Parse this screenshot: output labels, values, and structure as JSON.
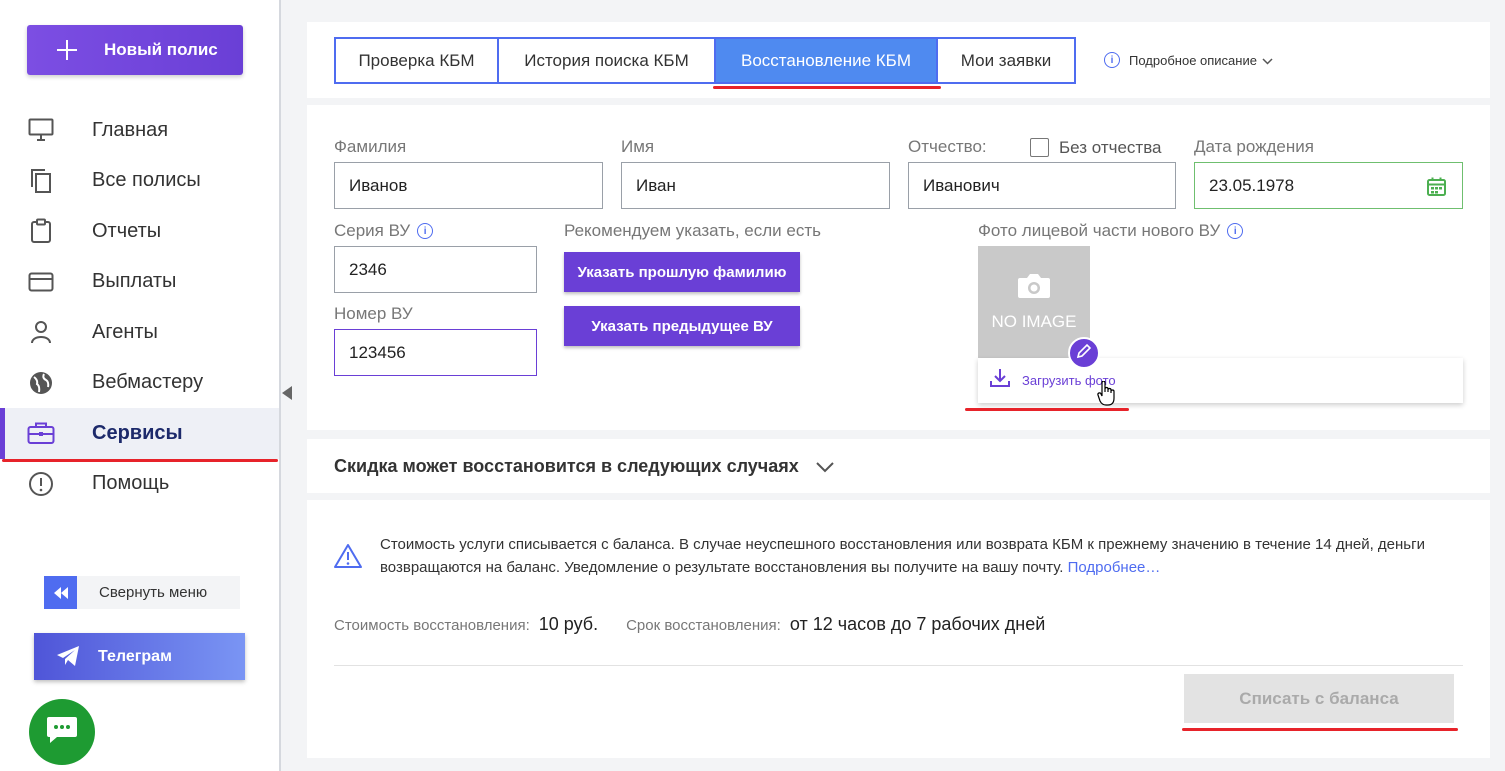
{
  "sidebar": {
    "new_policy": "Новый полис",
    "items": [
      {
        "label": "Главная",
        "icon": "monitor-icon"
      },
      {
        "label": "Все полисы",
        "icon": "copy-icon"
      },
      {
        "label": "Отчеты",
        "icon": "clipboard-icon"
      },
      {
        "label": "Выплаты",
        "icon": "credit-card-icon"
      },
      {
        "label": "Агенты",
        "icon": "user-icon"
      },
      {
        "label": "Вебмастеру",
        "icon": "globe-icon"
      },
      {
        "label": "Сервисы",
        "icon": "briefcase-icon",
        "active": true
      },
      {
        "label": "Помощь",
        "icon": "alert-circle-icon"
      }
    ],
    "collapse_label": "Свернуть меню",
    "telegram_label": "Телеграм"
  },
  "tabs": {
    "items": [
      "Проверка КБМ",
      "История поиска КБМ",
      "Восстановление КБМ",
      "Мои заявки"
    ],
    "active_index": 2,
    "detail_link": "Подробное описание"
  },
  "form": {
    "surname_label": "Фамилия",
    "surname_value": "Иванов",
    "name_label": "Имя",
    "name_value": "Иван",
    "patronymic_label": "Отчество:",
    "patronymic_value": "Иванович",
    "no_patronymic_label": "Без отчества",
    "birthdate_label": "Дата рождения",
    "birthdate_value": "23.05.1978",
    "series_label": "Серия ВУ",
    "series_value": "2346",
    "number_label": "Номер ВУ",
    "number_value": "123456",
    "recommend_label": "Рекомендуем указать, если есть",
    "prev_surname_button": "Указать прошлую фамилию",
    "prev_license_button": "Указать предыдущее ВУ",
    "photo_label": "Фото лицевой части нового ВУ",
    "no_image_text": "NO IMAGE",
    "upload_photo": "Загрузить фото"
  },
  "discount": {
    "title": "Скидка может восстановится в следующих случаях"
  },
  "payment": {
    "warning_text": "Стоимость услуги списывается с баланса. В случае неуспешного восстановления или возврата КБМ к прежнему значению в течение 14 дней, деньги возвращаются на баланс. Уведомление о результате восстановления вы получите на вашу почту.",
    "more_link": "Подробнее…",
    "cost_label": "Стоимость восстановления:",
    "cost_value": "10 руб.",
    "term_label": "Срок восстановления:",
    "term_value": "от 12 часов до 7 рабочих дней",
    "pay_button": "Списать с баланса"
  },
  "colors": {
    "accent_purple": "#6a3fd6",
    "accent_blue": "#4f6cf0",
    "highlight_red": "#e7232a"
  }
}
